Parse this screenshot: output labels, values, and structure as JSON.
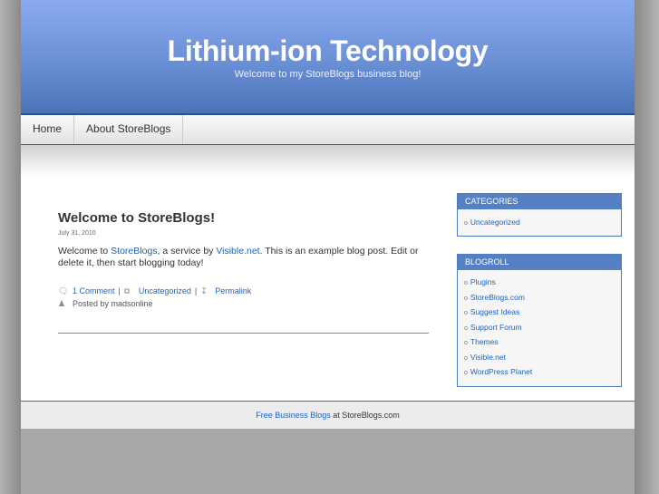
{
  "header": {
    "title": "Lithium-ion Technology",
    "tagline": "Welcome to my StoreBlogs business blog!"
  },
  "nav": {
    "items": [
      {
        "label": "Home"
      },
      {
        "label": "About StoreBlogs"
      }
    ]
  },
  "post": {
    "title": "Welcome to StoreBlogs!",
    "date": "July 31, 2010",
    "body": {
      "t1": "Welcome to ",
      "link1": "StoreBlogs",
      "t2": ", a service by ",
      "link2": "Visible.net",
      "t3": ". This is an example blog post. Edit or delete it, then start blogging today!"
    },
    "meta": {
      "comments": "1 Comment",
      "category": "Uncategorized",
      "permalink": "Permalink",
      "posted_by": "Posted by madsonline",
      "sep": "|"
    }
  },
  "sidebar": {
    "categories": {
      "title": "CATEGORIES",
      "items": [
        "Uncategorized"
      ]
    },
    "blogroll": {
      "title": "BLOGROLL",
      "items": [
        "Plugins",
        "StoreBlogs.com",
        "Suggest Ideas",
        "Support Forum",
        "Themes",
        "Visible.net",
        "WordPress Planet"
      ]
    }
  },
  "footer": {
    "link": "Free Business Blogs",
    "text": " at StoreBlogs.com"
  }
}
